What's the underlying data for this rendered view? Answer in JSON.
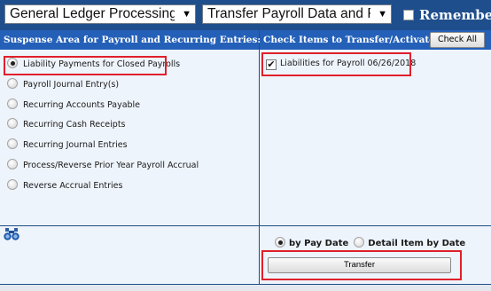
{
  "toolbar": {
    "process_select": "General Ledger Processing and",
    "action_select": "Transfer Payroll Data and Recurring",
    "remember_label": "Remember I",
    "remember_checked": false
  },
  "suspense_panel": {
    "header": "Suspense Area for Payroll and Recurring Entries:",
    "selected_index": 0,
    "items": [
      {
        "label": "Liability Payments for Closed Payrolls"
      },
      {
        "label": "Payroll Journal Entry(s)"
      },
      {
        "label": "Recurring Accounts Payable"
      },
      {
        "label": "Recurring Cash Receipts"
      },
      {
        "label": "Recurring Journal Entries"
      },
      {
        "label": "Process/Reverse Prior Year Payroll Accrual"
      },
      {
        "label": "Reverse Accrual Entries"
      }
    ]
  },
  "transfer_panel": {
    "header": "Check Items to Transfer/Activate:",
    "check_all_label": "Check All",
    "items": [
      {
        "label": "Liabilities for Payroll 06/26/2018",
        "checked": true
      }
    ]
  },
  "options": {
    "by_pay_date_label": "by Pay Date",
    "detail_by_date_label": "Detail Item by Date",
    "selected": "by Pay Date",
    "transfer_label": "Transfer"
  },
  "icons": {
    "search": "binoculars-icon",
    "dropdown": "caret-down-icon"
  },
  "colors": {
    "header_blue": "#2460b8",
    "panel_bg": "#eef4fb",
    "highlight_red": "#e0202c"
  }
}
